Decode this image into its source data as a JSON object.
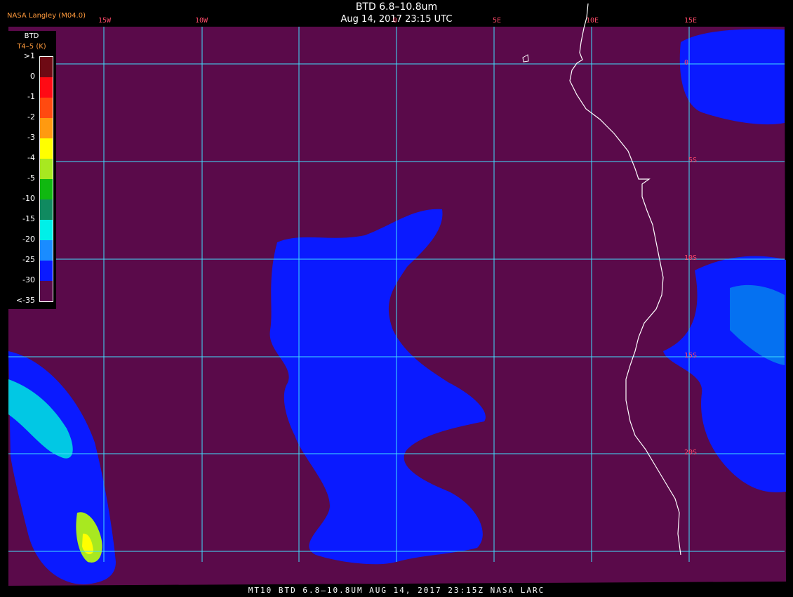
{
  "header": {
    "title": "BTD 6.8–10.8um",
    "subtitle": "Aug 14, 2017 23:15 UTC",
    "credit": "NASA Langley (M04.0)"
  },
  "footer": "MT10  BTD 6.8–10.8UM  AUG 14, 2017 23:15Z  NASA LARC",
  "legend": {
    "title": "BTD",
    "units": "T4–5 (K)",
    "entries": [
      {
        "label": ">1",
        "color": "#6e0a14"
      },
      {
        "label": "0",
        "color": "#ff0a14"
      },
      {
        "label": "-1",
        "color": "#ff4a10"
      },
      {
        "label": "-2",
        "color": "#ff9a10"
      },
      {
        "label": "-3",
        "color": "#ffff00"
      },
      {
        "label": "-4",
        "color": "#a8e820"
      },
      {
        "label": "-5",
        "color": "#10b810"
      },
      {
        "label": "-10",
        "color": "#108a60"
      },
      {
        "label": "-15",
        "color": "#00f0e8"
      },
      {
        "label": "-20",
        "color": "#1a8cff"
      },
      {
        "label": "-25",
        "color": "#0a1aff"
      },
      {
        "label": "-30",
        "color": "#5a0a4a"
      },
      {
        "label": "<-35",
        "color": ""
      }
    ]
  },
  "grid": {
    "lon_labels": [
      "15W",
      "10W",
      "0",
      "5E",
      "10E",
      "15E"
    ],
    "lat_labels": [
      "0",
      "5S",
      "10S",
      "15S",
      "20S"
    ]
  },
  "colors": {
    "background": "#5a0a4a",
    "gridline": "#40e0ff",
    "coastline": "#ffffff",
    "cloud": "#0a1aff"
  }
}
